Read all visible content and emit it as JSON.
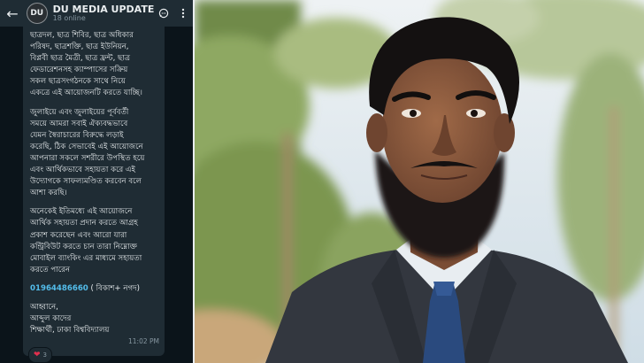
{
  "chat": {
    "header": {
      "avatar_text": "DU",
      "name": "DU MEDIA UPDATE",
      "status": "18 online",
      "back_icon": "arrow-left-icon",
      "icons": [
        "message-circle-icon",
        "more-vertical-icon"
      ]
    },
    "message": {
      "paragraphs": [
        [
          "ছাত্রদল, ছাত্র শিবির, ছাত্র অধিকার",
          "পরিষদ, ছাত্রশক্তি, ছাত্র ইউনিয়ন,",
          "বিপ্লবী ছাত্র মৈত্রী, ছাত্র ফ্রন্ট, ছাত্র",
          "ফেডারেশনসহ ক্যাম্পাসের সক্রিয়",
          "সকল ছাত্রসংগঠনকে সাথে নিয়ে",
          "একত্রে এই আয়োজনটি করতে যাচ্ছি।"
        ],
        [
          "জুলাইয়ে এবং জুলাইয়ের পূর্ববর্তী",
          "সময়ে আমরা সবাই ঐক্যবদ্ধভাবে",
          "যেমন স্বৈরাচারের বিরুদ্ধে লড়াই",
          "করেছি, ঠিক সেভাবেই এই আয়োজনে",
          "আপনারা সকলে সশরীরে উপস্থিত হয়ে",
          "এবং আর্থিকভাবে সহায়তা করে এই",
          "উদ্যোগকে সাফল্যমণ্ডিত করবেন বলে",
          "আশা করছি।"
        ],
        [
          "অনেকেই ইতিমধ্যে এই আয়োজনে",
          "আর্থিক সহায়তা প্রদান করতে আগ্রহ",
          "প্রকাশ করেছেন এবং আরো যারা",
          "কন্ট্রিবিউট করতে চান তারা নিম্নোক্ত",
          "মোবাইল ব্যাংকিং এর মাধ্যমে সহায়তা",
          "করতে পারেন"
        ]
      ],
      "phone": "01964486660",
      "phone_note": " ( বিকাশ+ নগদ)",
      "signature": [
        "আহ্বানে,",
        "আব্দুল কাদের",
        "শিক্ষার্থী, ঢাকা বিশ্ববিদ্যালয়"
      ],
      "time": "11:02 PM",
      "reaction_count": "3"
    }
  },
  "photo": {
    "subject": "person",
    "colors": {
      "sky": "#dfe8ee",
      "foliage": "#8aa35e",
      "suit": "#33373f",
      "shirt": "#e8edf1",
      "tie": "#2a4a7e",
      "skin": "#8a5a3e",
      "hair": "#141111"
    }
  }
}
